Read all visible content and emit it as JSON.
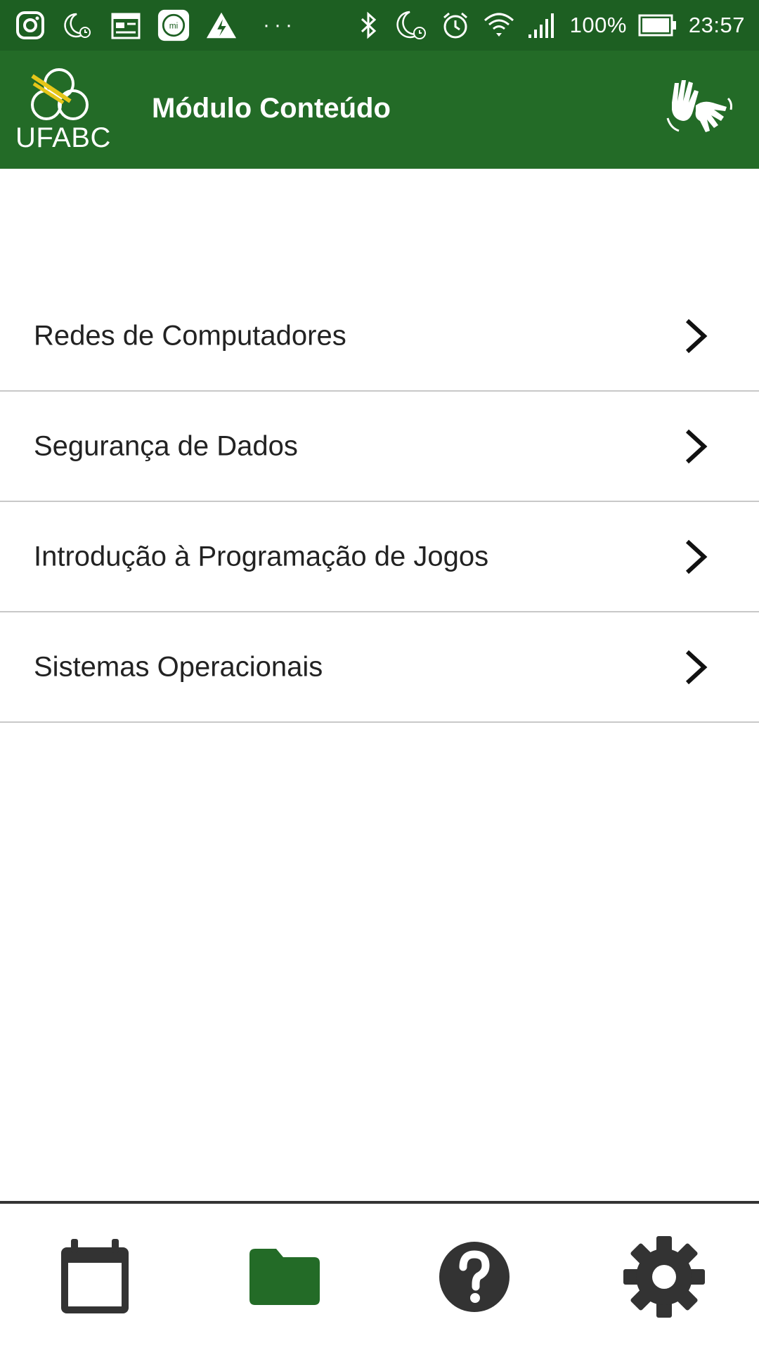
{
  "status_bar": {
    "left_icons": [
      "instagram-icon",
      "moon-alarm-icon",
      "calendar-news-icon",
      "mi-icon",
      "power-warning-icon"
    ],
    "more": "···",
    "battery_percent": "100%",
    "time": "23:57"
  },
  "app_bar": {
    "logo_text": "UFABC",
    "title": "Módulo Conteúdo",
    "action_icon": "sign-language-hands-icon"
  },
  "list": {
    "items": [
      {
        "label": "Redes de Computadores"
      },
      {
        "label": "Segurança de Dados"
      },
      {
        "label": "Introdução à Programação de Jogos"
      },
      {
        "label": "Sistemas Operacionais"
      }
    ]
  },
  "bottom_nav": {
    "items": [
      {
        "icon": "calendar-icon",
        "active": false
      },
      {
        "icon": "folder-icon",
        "active": true
      },
      {
        "icon": "help-icon",
        "active": false
      },
      {
        "icon": "settings-icon",
        "active": false
      }
    ]
  },
  "colors": {
    "status_bar": "#1d5f22",
    "app_bar": "#236b27",
    "active_icon": "#236b27",
    "inactive_icon": "#333333",
    "logo_accent": "#e6c619"
  }
}
